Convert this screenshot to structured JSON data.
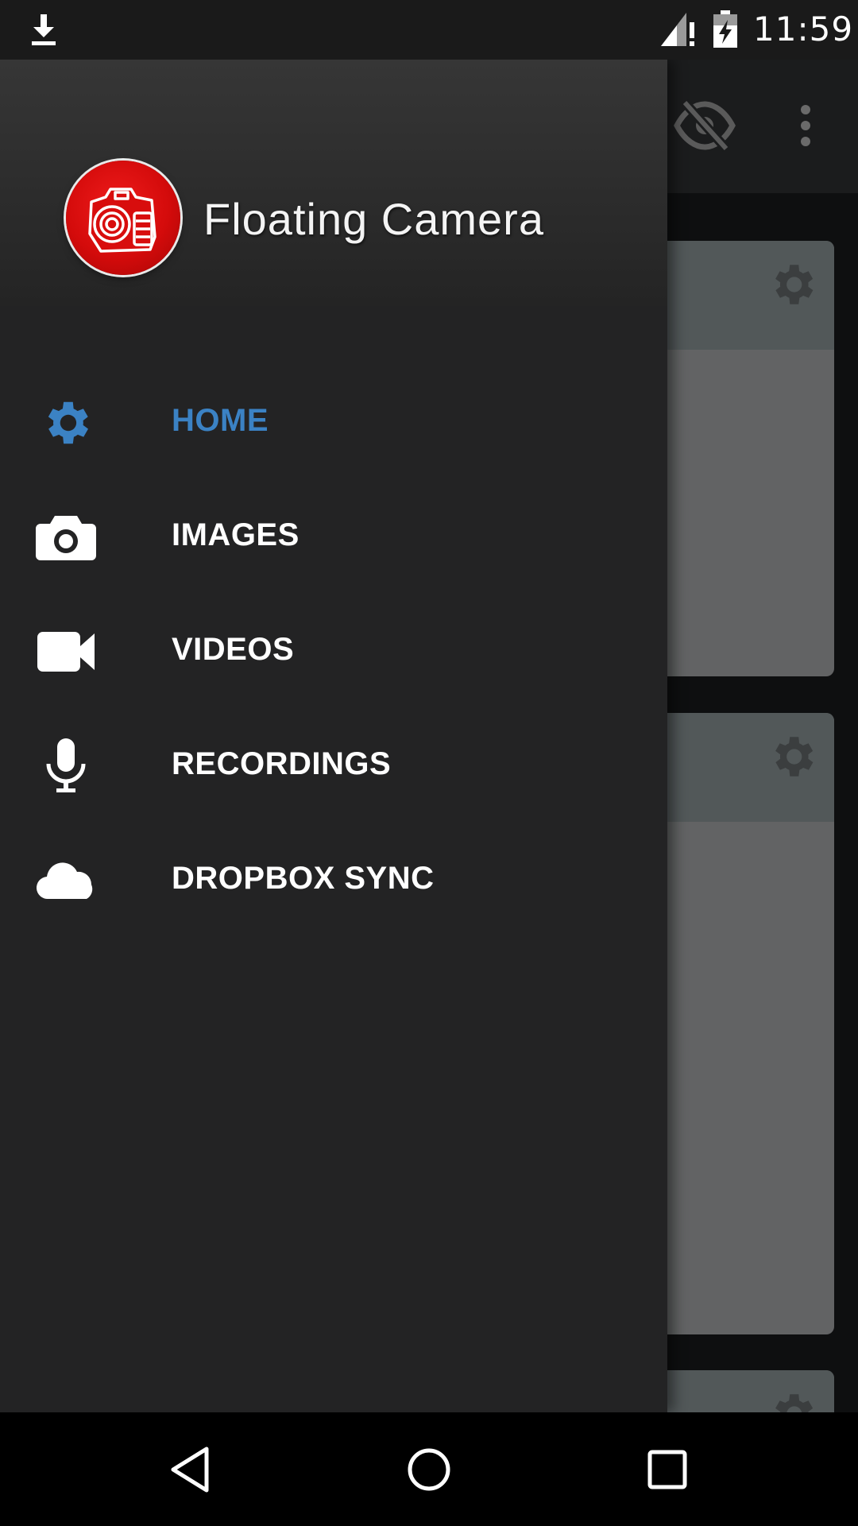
{
  "status_bar": {
    "time": "11:59",
    "icons": [
      "download-icon",
      "signal-icon",
      "battery-charging-icon"
    ]
  },
  "app_bar": {
    "icons": [
      "visibility-off-icon",
      "more-vert-icon"
    ]
  },
  "drawer": {
    "app_name": "Floating Camera",
    "logo_icon": "camera-logo-icon",
    "accent_color": "#3b82c4",
    "items": [
      {
        "label": "HOME",
        "icon": "gear-icon",
        "active": true
      },
      {
        "label": "IMAGES",
        "icon": "camera-icon",
        "active": false
      },
      {
        "label": "VIDEOS",
        "icon": "video-camera-icon",
        "active": false
      },
      {
        "label": "RECORDINGS",
        "icon": "microphone-icon",
        "active": false
      },
      {
        "label": "DROPBOX SYNC",
        "icon": "cloud-icon",
        "active": false
      }
    ]
  },
  "background_cards": {
    "icons": [
      "gear-icon",
      "gear-icon",
      "gear-icon"
    ]
  },
  "nav_bar": {
    "icons": [
      "back-icon",
      "home-icon",
      "recents-icon"
    ]
  }
}
